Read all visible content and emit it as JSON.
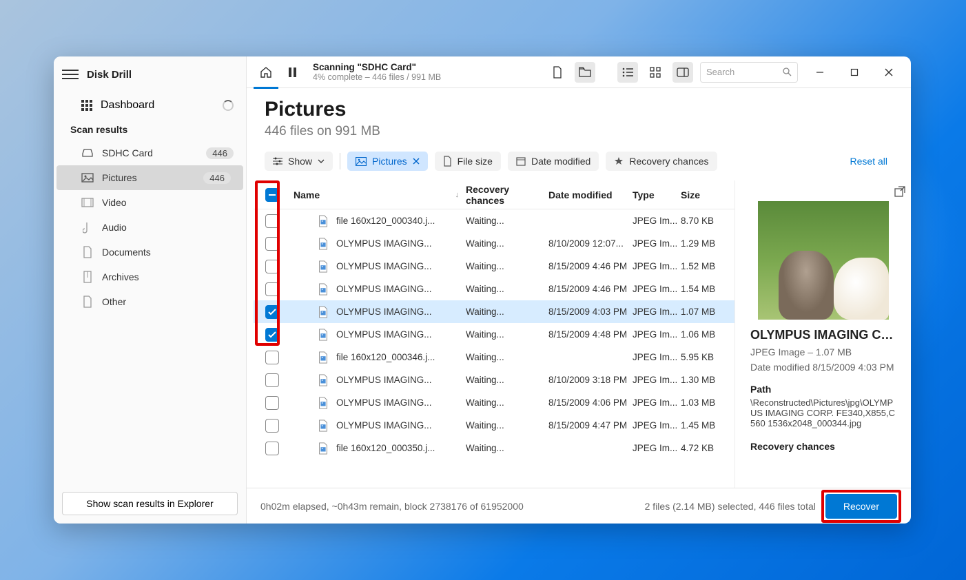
{
  "app": {
    "title": "Disk Drill"
  },
  "sidebar": {
    "dashboard": "Dashboard",
    "section": "Scan results",
    "items": [
      {
        "label": "SDHC Card",
        "badge": "446"
      },
      {
        "label": "Pictures",
        "badge": "446"
      },
      {
        "label": "Video"
      },
      {
        "label": "Audio"
      },
      {
        "label": "Documents"
      },
      {
        "label": "Archives"
      },
      {
        "label": "Other"
      }
    ],
    "explorer_btn": "Show scan results in Explorer"
  },
  "topbar": {
    "scan_title": "Scanning \"SDHC Card\"",
    "scan_sub": "4% complete – 446 files / 991 MB",
    "search_placeholder": "Search"
  },
  "header": {
    "title": "Pictures",
    "subtitle": "446 files on 991 MB"
  },
  "filters": {
    "show": "Show",
    "pictures": "Pictures",
    "filesize": "File size",
    "date": "Date modified",
    "recovery": "Recovery chances",
    "reset": "Reset all"
  },
  "table": {
    "columns": [
      "Name",
      "Recovery chances",
      "Date modified",
      "Type",
      "Size"
    ],
    "rows": [
      {
        "checked": false,
        "name": "file 160x120_000340.j...",
        "recov": "Waiting...",
        "date": "",
        "type": "JPEG Im...",
        "size": "8.70 KB"
      },
      {
        "checked": false,
        "name": "OLYMPUS IMAGING...",
        "recov": "Waiting...",
        "date": "8/10/2009 12:07...",
        "type": "JPEG Im...",
        "size": "1.29 MB"
      },
      {
        "checked": false,
        "name": "OLYMPUS IMAGING...",
        "recov": "Waiting...",
        "date": "8/15/2009 4:46 PM",
        "type": "JPEG Im...",
        "size": "1.52 MB"
      },
      {
        "checked": false,
        "name": "OLYMPUS IMAGING...",
        "recov": "Waiting...",
        "date": "8/15/2009 4:46 PM",
        "type": "JPEG Im...",
        "size": "1.54 MB"
      },
      {
        "checked": true,
        "selected": true,
        "name": "OLYMPUS IMAGING...",
        "recov": "Waiting...",
        "date": "8/15/2009 4:03 PM",
        "type": "JPEG Im...",
        "size": "1.07 MB"
      },
      {
        "checked": true,
        "name": "OLYMPUS IMAGING...",
        "recov": "Waiting...",
        "date": "8/15/2009 4:48 PM",
        "type": "JPEG Im...",
        "size": "1.06 MB"
      },
      {
        "checked": false,
        "name": "file 160x120_000346.j...",
        "recov": "Waiting...",
        "date": "",
        "type": "JPEG Im...",
        "size": "5.95 KB"
      },
      {
        "checked": false,
        "name": "OLYMPUS IMAGING...",
        "recov": "Waiting...",
        "date": "8/10/2009 3:18 PM",
        "type": "JPEG Im...",
        "size": "1.30 MB"
      },
      {
        "checked": false,
        "name": "OLYMPUS IMAGING...",
        "recov": "Waiting...",
        "date": "8/15/2009 4:06 PM",
        "type": "JPEG Im...",
        "size": "1.03 MB"
      },
      {
        "checked": false,
        "name": "OLYMPUS IMAGING...",
        "recov": "Waiting...",
        "date": "8/15/2009 4:47 PM",
        "type": "JPEG Im...",
        "size": "1.45 MB"
      },
      {
        "checked": false,
        "name": "file 160x120_000350.j...",
        "recov": "Waiting...",
        "date": "",
        "type": "JPEG Im...",
        "size": "4.72 KB"
      }
    ]
  },
  "preview": {
    "name": "OLYMPUS IMAGING COR...",
    "meta": "JPEG Image – 1.07 MB",
    "date": "Date modified 8/15/2009 4:03 PM",
    "path_label": "Path",
    "path": "\\Reconstructed\\Pictures\\jpg\\OLYMPUS IMAGING CORP. FE340,X855,C560 1536x2048_000344.jpg",
    "recovery_label": "Recovery chances"
  },
  "footer": {
    "status": "0h02m elapsed, ~0h43m remain, block 2738176 of 61952000",
    "selection": "2 files (2.14 MB) selected, 446 files total",
    "recover": "Recover"
  }
}
